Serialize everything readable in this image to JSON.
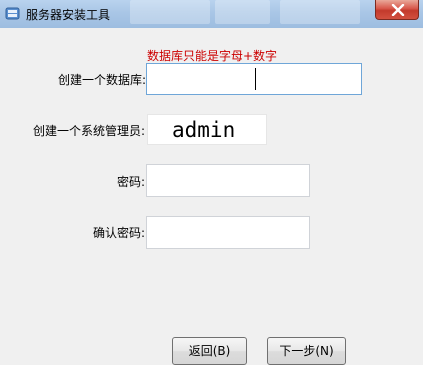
{
  "window": {
    "title": "服务器安装工具",
    "close_label": "×"
  },
  "form": {
    "hint": "数据库只能是字母+数字",
    "db_label": "创建一个数据库:",
    "db_value": "",
    "sysadmin_label": "创建一个系统管理员:",
    "sysadmin_value": "admin",
    "password_label": "密码:",
    "password_value": "",
    "confirm_label": "确认密码:",
    "confirm_value": ""
  },
  "buttons": {
    "back_label": "返回(B)",
    "next_label": "下一步(N)"
  },
  "colors": {
    "hint": "#cc0000",
    "titlebar": "#a9c6e6",
    "close": "#c23a2c"
  }
}
